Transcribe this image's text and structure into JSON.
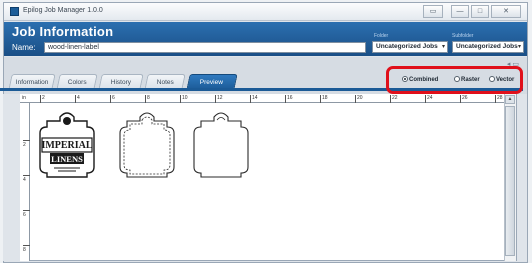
{
  "window": {
    "title": "Epilog Job Manager 1.0.0",
    "minimize_label": "—",
    "maximize_label": "□",
    "close_label": "✕",
    "extra_label": "▭"
  },
  "header": {
    "title": "Job Information",
    "name_label": "Name:",
    "name_value": "wood-linen-label",
    "folder_label": "Folder",
    "subfolder_label": "Subfolder",
    "folder_value": "Uncategorized Jobs",
    "subfolder_value": "Uncategorized Jobs"
  },
  "tabs": [
    {
      "label": "Information"
    },
    {
      "label": "Colors"
    },
    {
      "label": "History"
    },
    {
      "label": "Notes"
    },
    {
      "label": "Preview",
      "active": true
    }
  ],
  "render_mode": {
    "options": [
      "Combined",
      "Raster",
      "Vector"
    ],
    "selected": "Combined"
  },
  "ruler": {
    "corner": "in",
    "h_labels": [
      "2",
      "4",
      "6",
      "8",
      "10",
      "12",
      "14",
      "16",
      "18",
      "20",
      "22",
      "24",
      "26",
      "28"
    ],
    "v_labels": [
      "2",
      "4",
      "6",
      "8"
    ]
  },
  "artwork": {
    "logo_line1": "IMPERIAL",
    "logo_line2": "LINENS"
  },
  "colors": {
    "header_blue": "#1f5d9a",
    "tab_active": "#2f79bf",
    "highlight_red": "#e0101b"
  }
}
